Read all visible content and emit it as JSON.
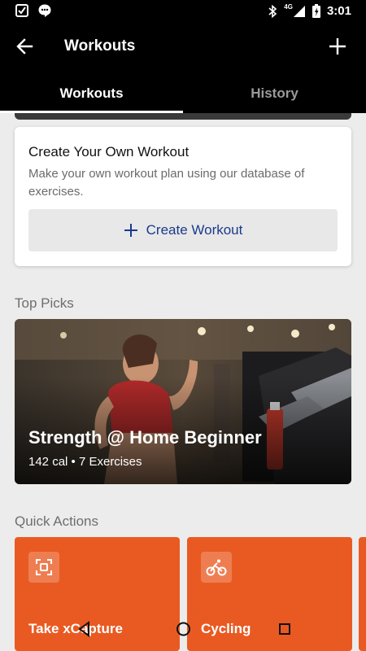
{
  "status_bar": {
    "time": "3:01",
    "network": "4G",
    "left_icons": [
      "checklist-icon",
      "message-icon"
    ],
    "right_icons": [
      "bluetooth-icon",
      "signal-icon",
      "battery-icon"
    ]
  },
  "app_bar": {
    "title": "Workouts",
    "icons": {
      "back": "arrow-left-icon",
      "add": "plus-icon"
    }
  },
  "tabs": [
    {
      "label": "Workouts",
      "active": true
    },
    {
      "label": "History",
      "active": false
    }
  ],
  "create_card": {
    "title": "Create Your Own Workout",
    "description": "Make your own workout plan using our database of exercises.",
    "button_label": "Create Workout"
  },
  "top_picks": {
    "heading": "Top Picks",
    "items": [
      {
        "title": "Strength @ Home Beginner",
        "meta": "142 cal • 7 Exercises"
      }
    ]
  },
  "quick_actions": {
    "heading": "Quick Actions",
    "items": [
      {
        "label": "Take xCapture",
        "icon": "scan-icon"
      },
      {
        "label": "Cycling",
        "icon": "cycling-icon"
      }
    ]
  },
  "colors": {
    "accent": "#e95a22",
    "link_blue": "#1b3a8c",
    "background": "#ececec"
  }
}
